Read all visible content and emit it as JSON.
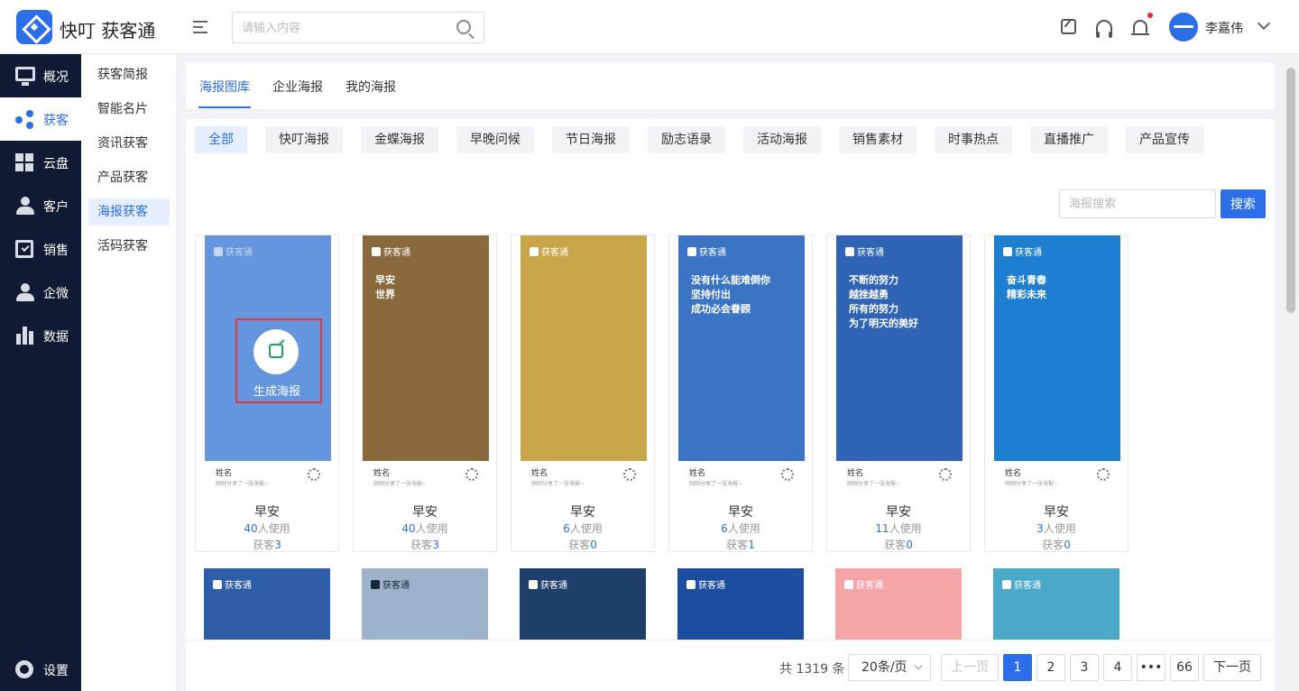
{
  "header": {
    "brand": "快叮 获客通",
    "search_placeholder": "请输入内容",
    "user_name": "李嘉伟"
  },
  "sidebar": {
    "items": [
      {
        "label": "概况",
        "icon": "monitor-icon"
      },
      {
        "label": "获客",
        "icon": "share-icon",
        "active": true
      },
      {
        "label": "云盘",
        "icon": "grid-icon"
      },
      {
        "label": "客户",
        "icon": "user-icon"
      },
      {
        "label": "销售",
        "icon": "clipboard-icon"
      },
      {
        "label": "企微",
        "icon": "person-icon"
      },
      {
        "label": "数据",
        "icon": "bar-chart-icon"
      }
    ],
    "settings": "设置"
  },
  "subnav": {
    "items": [
      "获客简报",
      "智能名片",
      "资讯获客",
      "产品获客",
      "海报获客",
      "活码获客"
    ],
    "active_index": 4
  },
  "tabs": [
    "海报图库",
    "企业海报",
    "我的海报"
  ],
  "categories": [
    "全部",
    "快叮海报",
    "金蝶海报",
    "早晚问候",
    "节日海报",
    "励志语录",
    "活动海报",
    "销售素材",
    "时事热点",
    "直播推广",
    "产品宣传"
  ],
  "poster_search": {
    "placeholder": "海报搜索",
    "button": "搜索"
  },
  "overlay": {
    "label": "生成海报"
  },
  "card_meta": {
    "name": "姓名",
    "sub": "刚刚分享了一张海报~",
    "brand": "获客通",
    "use_suffix": "人使用",
    "gain_prefix": "获客"
  },
  "cards": [
    {
      "title": "早安",
      "uses": "40",
      "gains": "3",
      "text": "",
      "bg": "#6b9be0"
    },
    {
      "title": "早安",
      "uses": "40",
      "gains": "3",
      "text": "早安\n世界",
      "bg": "#8a6a3c"
    },
    {
      "title": "早安",
      "uses": "6",
      "gains": "0",
      "text": "",
      "bg": "#c9a64a"
    },
    {
      "title": "早安",
      "uses": "6",
      "gains": "1",
      "text": "没有什么能难倒你\n坚持付出\n成功必会眷顾",
      "bg": "#3b74c4"
    },
    {
      "title": "早安",
      "uses": "11",
      "gains": "0",
      "text": "不断的努力\n越挫越勇\n所有的努力\n为了明天的美好",
      "bg": "#2f63b5"
    },
    {
      "title": "早安",
      "uses": "3",
      "gains": "0",
      "text": "奋斗青春\n精彩未来",
      "bg": "#1e7fd0"
    }
  ],
  "pagination": {
    "total": "共 1319 条",
    "page_size": "20条/页",
    "prev": "上一页",
    "next": "下一页",
    "pages": [
      "1",
      "2",
      "3",
      "4",
      "•••",
      "66"
    ]
  },
  "colors": {
    "accent": "#2c6ee8",
    "sidebar_bg": "#0f1b33"
  }
}
